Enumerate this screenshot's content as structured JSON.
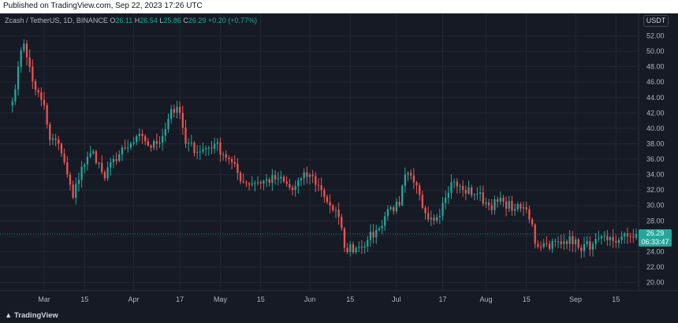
{
  "header": {
    "published": "Published on TradingView.com, Sep 22, 2023 17:26 UTC"
  },
  "legend": {
    "symbol": "Zcash / TetherUS, 1D, BINANCE",
    "open_label": "O",
    "open": "26.11",
    "high_label": "H",
    "high": "26.54",
    "low_label": "L",
    "low": "25.86",
    "close_label": "C",
    "close": "26.29",
    "change": "+0.20 (+0.77%)"
  },
  "currency": "USDT",
  "last_price": {
    "value": "26.29",
    "countdown": "06:33:47"
  },
  "footer": {
    "brand": "TradingView"
  },
  "colors": {
    "up": "#26a69a",
    "down": "#ef5350",
    "background": "#161a25",
    "grid": "#232733"
  },
  "chart_data": {
    "type": "candlestick",
    "ylim": [
      19,
      53
    ],
    "y_ticks": [
      "52.00",
      "50.00",
      "48.00",
      "46.00",
      "44.00",
      "42.00",
      "40.00",
      "38.00",
      "36.00",
      "34.00",
      "32.00",
      "30.00",
      "28.00",
      "26.00",
      "24.00",
      "22.00",
      "20.00"
    ],
    "x_ticks": [
      {
        "label": "Mar",
        "day": 0
      },
      {
        "label": "15",
        "day": 14
      },
      {
        "label": "Apr",
        "day": 31
      },
      {
        "label": "17",
        "day": 47
      },
      {
        "label": "May",
        "day": 61
      },
      {
        "label": "15",
        "day": 75
      },
      {
        "label": "Jun",
        "day": 92
      },
      {
        "label": "15",
        "day": 106
      },
      {
        "label": "Jul",
        "day": 122
      },
      {
        "label": "17",
        "day": 138
      },
      {
        "label": "Aug",
        "day": 153
      },
      {
        "label": "15",
        "day": 167
      },
      {
        "label": "Sep",
        "day": 184
      },
      {
        "label": "15",
        "day": 198
      }
    ],
    "anchors": [
      {
        "date": "2023-02-18",
        "close": 43.5
      },
      {
        "date": "2023-02-20",
        "close": 48.0
      },
      {
        "date": "2023-02-22",
        "close": 51.0
      },
      {
        "date": "2023-02-24",
        "close": 48.0
      },
      {
        "date": "2023-02-26",
        "close": 45.0
      },
      {
        "date": "2023-03-01",
        "close": 43.0
      },
      {
        "date": "2023-03-03",
        "close": 38.5
      },
      {
        "date": "2023-03-06",
        "close": 38.0
      },
      {
        "date": "2023-03-09",
        "close": 34.0
      },
      {
        "date": "2023-03-11",
        "close": 31.0
      },
      {
        "date": "2023-03-14",
        "close": 35.0
      },
      {
        "date": "2023-03-18",
        "close": 37.0
      },
      {
        "date": "2023-03-22",
        "close": 33.5
      },
      {
        "date": "2023-03-25",
        "close": 36.0
      },
      {
        "date": "2023-03-30",
        "close": 37.5
      },
      {
        "date": "2023-04-04",
        "close": 39.0
      },
      {
        "date": "2023-04-07",
        "close": 37.5
      },
      {
        "date": "2023-04-11",
        "close": 39.0
      },
      {
        "date": "2023-04-14",
        "close": 42.5
      },
      {
        "date": "2023-04-17",
        "close": 42.0
      },
      {
        "date": "2023-04-19",
        "close": 38.0
      },
      {
        "date": "2023-04-24",
        "close": 37.0
      },
      {
        "date": "2023-04-29",
        "close": 38.0
      },
      {
        "date": "2023-05-04",
        "close": 36.0
      },
      {
        "date": "2023-05-09",
        "close": 33.0
      },
      {
        "date": "2023-05-14",
        "close": 33.0
      },
      {
        "date": "2023-05-21",
        "close": 33.5
      },
      {
        "date": "2023-05-26",
        "close": 32.0
      },
      {
        "date": "2023-05-29",
        "close": 33.5
      },
      {
        "date": "2023-06-01",
        "close": 34.0
      },
      {
        "date": "2023-06-05",
        "close": 32.0
      },
      {
        "date": "2023-06-08",
        "close": 30.0
      },
      {
        "date": "2023-06-11",
        "close": 28.5
      },
      {
        "date": "2023-06-13",
        "close": 24.5
      },
      {
        "date": "2023-06-17",
        "close": 24.5
      },
      {
        "date": "2023-06-21",
        "close": 25.5
      },
      {
        "date": "2023-06-25",
        "close": 27.0
      },
      {
        "date": "2023-06-28",
        "close": 29.5
      },
      {
        "date": "2023-07-02",
        "close": 30.0
      },
      {
        "date": "2023-07-04",
        "close": 34.0
      },
      {
        "date": "2023-07-07",
        "close": 33.0
      },
      {
        "date": "2023-07-11",
        "close": 29.0
      },
      {
        "date": "2023-07-15",
        "close": 28.5
      },
      {
        "date": "2023-07-18",
        "close": 31.0
      },
      {
        "date": "2023-07-20",
        "close": 33.0
      },
      {
        "date": "2023-07-24",
        "close": 32.0
      },
      {
        "date": "2023-07-29",
        "close": 31.5
      },
      {
        "date": "2023-08-02",
        "close": 30.0
      },
      {
        "date": "2023-08-07",
        "close": 30.5
      },
      {
        "date": "2023-08-11",
        "close": 29.5
      },
      {
        "date": "2023-08-15",
        "close": 29.5
      },
      {
        "date": "2023-08-17",
        "close": 27.5
      },
      {
        "date": "2023-08-18",
        "close": 25.0
      },
      {
        "date": "2023-08-22",
        "close": 25.0
      },
      {
        "date": "2023-08-27",
        "close": 25.0
      },
      {
        "date": "2023-08-30",
        "close": 26.0
      },
      {
        "date": "2023-09-02",
        "close": 24.5
      },
      {
        "date": "2023-09-07",
        "close": 25.0
      },
      {
        "date": "2023-09-12",
        "close": 25.5
      },
      {
        "date": "2023-09-16",
        "close": 25.5
      },
      {
        "date": "2023-09-19",
        "close": 26.0
      },
      {
        "date": "2023-09-22",
        "close": 26.29
      }
    ],
    "last_close": 26.29
  }
}
